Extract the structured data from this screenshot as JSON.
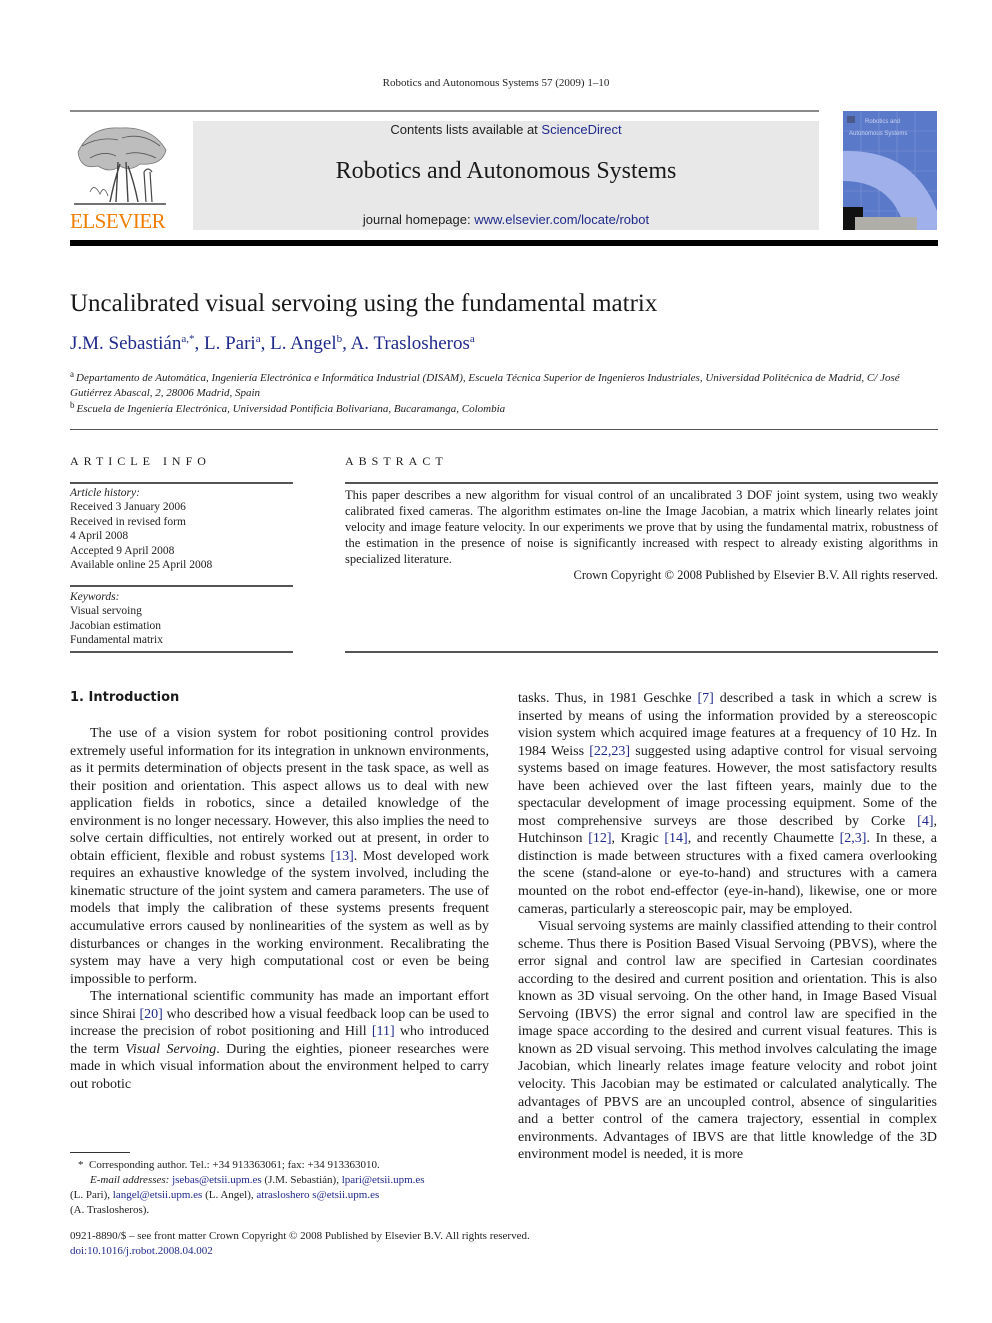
{
  "running_head": "Robotics and Autonomous Systems 57 (2009) 1–10",
  "publisher": {
    "wordmark": "ELSEVIER",
    "logo_icon": "elsevier-tree-icon",
    "color": "#f07d00"
  },
  "banner": {
    "contents_prefix": "Contents lists available at ",
    "contents_link": "ScienceDirect",
    "journal_title": "Robotics and Autonomous Systems",
    "homepage_prefix": "journal homepage: ",
    "homepage_link": "www.elsevier.com/locate/robot"
  },
  "cover": {
    "title_line1": "Robotics and",
    "title_line2": "Autonomous Systems"
  },
  "article": {
    "title": "Uncalibrated visual servoing using the fundamental matrix",
    "authors": [
      {
        "name": "J.M. Sebastián",
        "sup": "a,*"
      },
      {
        "name": "L. Pari",
        "sup": "a"
      },
      {
        "name": "L. Angel",
        "sup": "b"
      },
      {
        "name": "A. Traslosheros",
        "sup": "a"
      }
    ],
    "affiliations": [
      {
        "mark": "a",
        "text": "Departamento de Automática, Ingeniería Electrónica e Informática Industrial (DISAM), Escuela Técnica Superior de Ingenieros Industriales, Universidad Politécnica de Madrid, C/ José Gutiérrez Abascal, 2, 28006 Madrid, Spain"
      },
      {
        "mark": "b",
        "text": "Escuela de Ingeniería Electrónica, Universidad Pontificia Bolivariana, Bucaramanga, Colombia"
      }
    ]
  },
  "article_info": {
    "heading": "ARTICLE INFO",
    "history_label": "Article history:",
    "history": [
      "Received 3 January 2006",
      "Received in revised form",
      "4 April 2008",
      "Accepted 9 April 2008",
      "Available online 25 April 2008"
    ],
    "keywords_label": "Keywords:",
    "keywords": [
      "Visual servoing",
      "Jacobian estimation",
      "Fundamental matrix"
    ]
  },
  "abstract": {
    "heading": "ABSTRACT",
    "text": "This paper describes a new algorithm for visual control of an uncalibrated 3 DOF joint system, using two weakly calibrated fixed cameras. The algorithm estimates on-line the Image Jacobian, a matrix which linearly relates joint velocity and image feature velocity. In our experiments we prove that by using the fundamental matrix, robustness of the estimation in the presence of noise is significantly increased with respect to already existing algorithms in specialized literature.",
    "copyright": "Crown Copyright © 2008 Published by Elsevier B.V. All rights reserved."
  },
  "body": {
    "section_heading": "1.  Introduction",
    "left_paragraphs": [
      [
        {
          "t": "The use of a vision system for robot positioning control provides extremely useful information for its integration in unknown environments, as it permits determination of objects present in the task space, as well as their position and orientation. This aspect allows us to deal with new application fields in robotics, since a detailed knowledge of the environment is no longer necessary. However, this also implies the need to solve certain difficulties, not entirely worked out at present, in order to obtain efficient, flexible and robust systems "
        },
        {
          "c": "[13]"
        },
        {
          "t": ". Most developed work requires an exhaustive knowledge of the system involved, including the kinematic structure of the joint system and camera parameters. The use of models that imply the calibration of these systems presents frequent accumulative errors caused by nonlinearities of the system as well as by disturbances or changes in the working environment. Recalibrating the system may have a very high computational cost or even be being impossible to perform."
        }
      ],
      [
        {
          "t": "The international scientific community has made an important effort since Shirai "
        },
        {
          "c": "[20]"
        },
        {
          "t": " who described how a visual feedback loop can be used to increase the precision of robot positioning and Hill "
        },
        {
          "c": "[11]"
        },
        {
          "t": " who introduced the term "
        },
        {
          "i": "Visual Servoing"
        },
        {
          "t": ". During the eighties, pioneer researches were made in which visual information about the environment helped to carry out robotic"
        }
      ]
    ],
    "right_paragraphs": [
      [
        {
          "t": "tasks. Thus, in 1981 Geschke "
        },
        {
          "c": "[7]"
        },
        {
          "t": " described a task in which a screw is inserted by means of using the information provided by a stereoscopic vision system which acquired image features at a frequency of 10 Hz. In 1984 Weiss "
        },
        {
          "c": "[22,23]"
        },
        {
          "t": " suggested using adaptive control for visual servoing systems based on image features. However, the most satisfactory results have been achieved over the last fifteen years, mainly due to the spectacular development of image processing equipment. Some of the most comprehensive surveys are those described by Corke "
        },
        {
          "c": "[4]"
        },
        {
          "t": ", Hutchinson "
        },
        {
          "c": "[12]"
        },
        {
          "t": ", Kragic "
        },
        {
          "c": "[14]"
        },
        {
          "t": ", and recently Chaumette "
        },
        {
          "c": "[2,3]"
        },
        {
          "t": ". In these, a distinction is made between structures with a fixed camera overlooking the scene (stand-alone or eye-to-hand) and structures with a camera mounted on the robot end-effector (eye-in-hand), likewise, one or more cameras, particularly a stereoscopic pair, may be employed."
        }
      ],
      [
        {
          "t": "Visual servoing systems are mainly classified attending to their control scheme. Thus there is Position Based Visual Servoing (PBVS), where the error signal and control law are specified in Cartesian coordinates according to the desired and current position and orientation. This is also known as 3D visual servoing. On the other hand, in Image Based Visual Servoing (IBVS) the error signal and control law are specified in the image space according to the desired and current visual features. This is known as 2D visual servoing. This method involves calculating the image Jacobian, which linearly relates image feature velocity and robot joint velocity. This Jacobian may be estimated or calculated analytically. The advantages of PBVS are an uncoupled control, absence of singularities and a better control of the camera trajectory, essential in complex environments. Advantages of IBVS are that little knowledge of the 3D environment model is needed, it is more"
        }
      ]
    ]
  },
  "footnote": {
    "star": "*",
    "corresponding": "Corresponding author. Tel.: +34 913363061; fax: +34 913363010.",
    "email_label": "E-mail addresses:",
    "emails": [
      {
        "addr": "jsebas@etsii.upm.es",
        "who": "(J.M. Sebastián)"
      },
      {
        "addr": "lpari@etsii.upm.es",
        "who": "(L. Pari)"
      },
      {
        "addr": "langel@etsii.upm.es",
        "who": "(L. Angel)"
      },
      {
        "addr": "atrasloshero s@etsii.upm.es",
        "who": "(A. Traslosheros)."
      }
    ]
  },
  "issn_line": "0921-8890/$ – see front matter Crown Copyright © 2008 Published by Elsevier B.V. All rights reserved.",
  "doi": "doi:10.1016/j.robot.2008.04.002"
}
